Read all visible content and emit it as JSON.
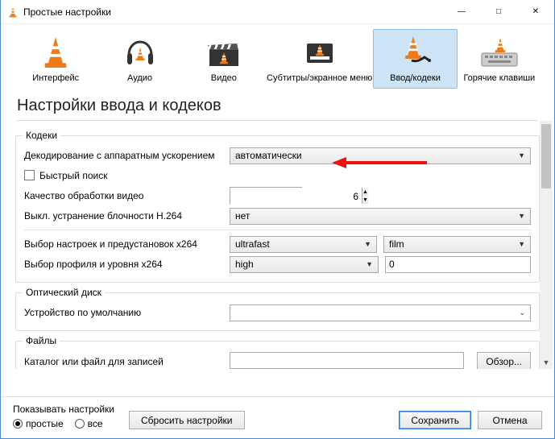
{
  "window": {
    "title": "Простые настройки"
  },
  "categories": [
    {
      "id": "interface",
      "label": "Интерфейс"
    },
    {
      "id": "audio",
      "label": "Аудио"
    },
    {
      "id": "video",
      "label": "Видео"
    },
    {
      "id": "subs",
      "label": "Субтитры/экранное меню"
    },
    {
      "id": "input",
      "label": "Ввод/кодеки",
      "selected": true
    },
    {
      "id": "hotkeys",
      "label": "Горячие клавиши"
    }
  ],
  "heading": "Настройки ввода и кодеков",
  "groups": {
    "codecs": {
      "legend": "Кодеки",
      "hwdec_label": "Декодирование с аппаратным ускорением",
      "hwdec_value": "автоматически",
      "fastseek_label": "Быстрый поиск",
      "fastseek_checked": false,
      "videoquality_label": "Качество обработки видео",
      "videoquality_value": "6",
      "deblock_label": "Выкл. устранение блочности H.264",
      "deblock_value": "нет",
      "x264preset_label": "Выбор настроек и предустановок х264",
      "x264preset_value": "ultrafast",
      "x264tune_value": "film",
      "x264profile_label": "Выбор профиля и уровня х264",
      "x264profile_value": "high",
      "x264level_value": "0"
    },
    "optical": {
      "legend": "Оптический диск",
      "device_label": "Устройство по умолчанию",
      "device_value": ""
    },
    "files": {
      "legend": "Файлы",
      "recdir_label": "Каталог или файл для записей",
      "recdir_value": "",
      "browse_label": "Обзор..."
    }
  },
  "bottom": {
    "show_label": "Показывать настройки",
    "radio_simple": "простые",
    "radio_all": "все",
    "reset": "Сбросить настройки",
    "save": "Сохранить",
    "cancel": "Отмена"
  }
}
